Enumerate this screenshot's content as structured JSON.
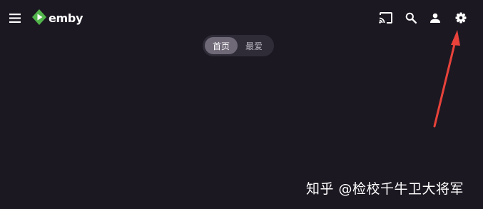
{
  "header": {
    "menu_icon": "hamburger-menu-icon",
    "logo_icon": "emby-logo-icon",
    "logo_text": "emby",
    "cast_icon": "cast-icon",
    "search_icon": "search-icon",
    "user_icon": "user-icon",
    "settings_icon": "gear-icon"
  },
  "tabs": [
    {
      "label": "首页",
      "active": true
    },
    {
      "label": "最爱",
      "active": false
    }
  ],
  "watermark": "知乎 @检校千牛卫大将军",
  "annotation": {
    "arrow_color": "#e8423a",
    "points_to": "settings"
  },
  "colors": {
    "background": "#1c1822",
    "logo_green": "#52b54b",
    "tab_active": "#6f6877",
    "tab_container": "#2f2c38"
  }
}
